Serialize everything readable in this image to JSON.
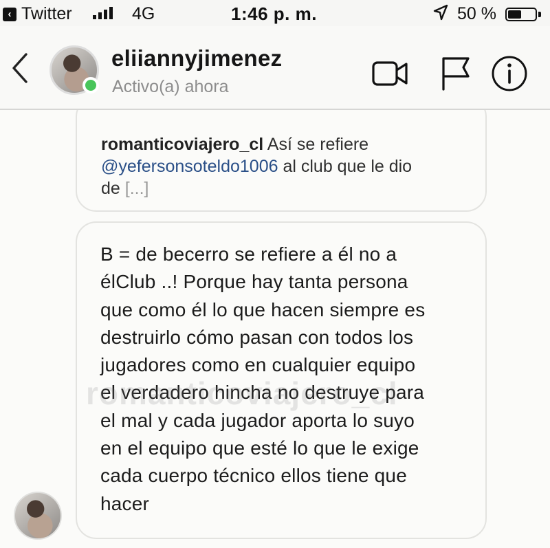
{
  "status_bar": {
    "back_app": "Twitter",
    "network": "4G",
    "time": "1:46 p. m.",
    "battery_percent": "50 %",
    "battery_level": 0.5
  },
  "header": {
    "username": "eliiannyjimenez",
    "activity": "Activo(a) ahora"
  },
  "shared_post": {
    "user": "romanticoviajero_cl",
    "text": "Así se refiere",
    "mention": "@yefersonsoteldo1006",
    "text2": "al club que le dio",
    "text3": "de",
    "more": "[...]"
  },
  "message": {
    "lines": [
      "B = de becerro se refiere a él no a",
      "élClub ..! Porque hay tanta persona",
      "que como él lo que hacen siempre es",
      "destruirlo cómo pasan con todos los",
      "jugadores como en cualquier equipo",
      "el verdadero hincha no destruye para",
      "el mal y cada jugador aporta lo suyo",
      "en el equipo que esté lo que le exige",
      "cada cuerpo técnico ellos tiene que",
      "hacer"
    ]
  },
  "watermark": "romanticoviajero_cl",
  "icons": [
    "back-chevron-icon",
    "video-call-icon",
    "flag-icon",
    "info-icon",
    "location-arrow-icon",
    "battery-icon",
    "signal-icon"
  ]
}
